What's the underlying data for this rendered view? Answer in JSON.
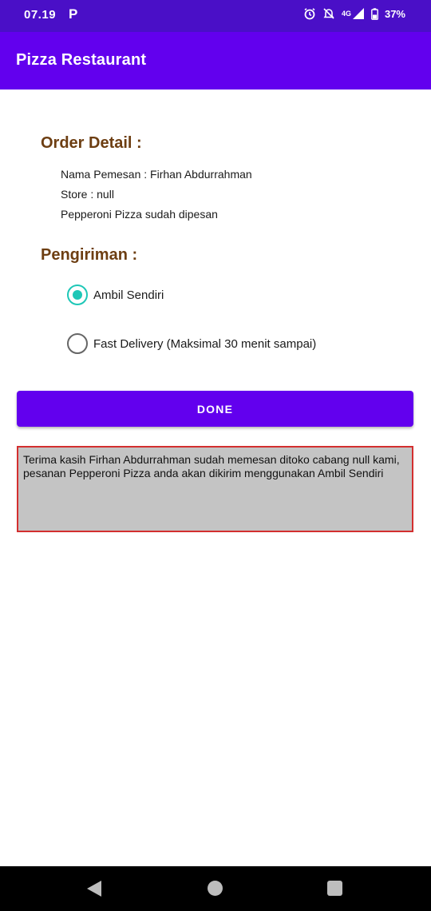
{
  "status_bar": {
    "time": "07.19",
    "app_letter": "P",
    "network": "4G",
    "battery": "37%"
  },
  "app_bar": {
    "title": "Pizza Restaurant"
  },
  "order_detail": {
    "title": "Order Detail :",
    "customer_line": "Nama Pemesan : Firhan Abdurrahman",
    "store_line": "Store : null",
    "item_line": "Pepperoni Pizza sudah dipesan"
  },
  "delivery": {
    "title": "Pengiriman :",
    "options": [
      {
        "label": "Ambil Sendiri",
        "checked": true
      },
      {
        "label": "Fast Delivery (Maksimal 30 menit sampai)",
        "checked": false
      }
    ]
  },
  "done_button": {
    "label": "DONE"
  },
  "message": {
    "text": "Terima kasih Firhan Abdurrahman sudah memesan ditoko cabang null kami, pesanan Pepperoni Pizza anda akan dikirim menggunakan Ambil Sendiri"
  },
  "colors": {
    "status_bar": "#4a0fc7",
    "primary": "#6200ee",
    "section_title": "#6d3e12",
    "radio_accent": "#1ec7b7",
    "message_background": "#c4c4c4",
    "message_border": "#d32f2f"
  }
}
